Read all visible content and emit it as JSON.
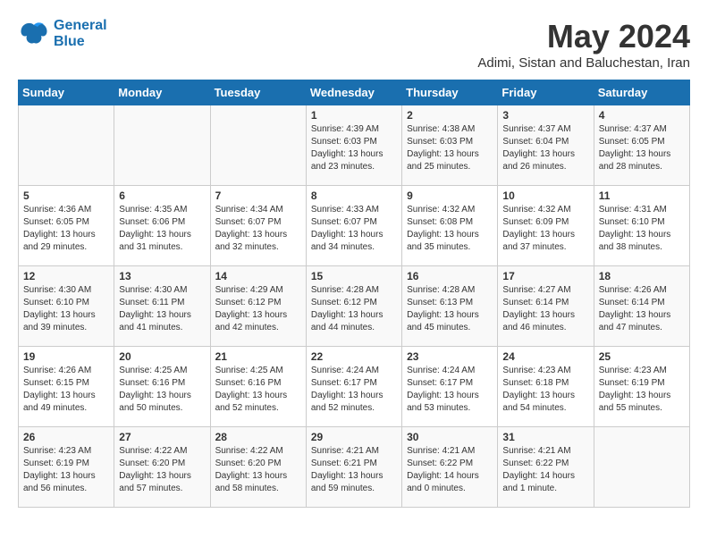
{
  "logo": {
    "line1": "General",
    "line2": "Blue"
  },
  "title": "May 2024",
  "subtitle": "Adimi, Sistan and Baluchestan, Iran",
  "days_of_week": [
    "Sunday",
    "Monday",
    "Tuesday",
    "Wednesday",
    "Thursday",
    "Friday",
    "Saturday"
  ],
  "weeks": [
    [
      {
        "day": "",
        "info": ""
      },
      {
        "day": "",
        "info": ""
      },
      {
        "day": "",
        "info": ""
      },
      {
        "day": "1",
        "info": "Sunrise: 4:39 AM\nSunset: 6:03 PM\nDaylight: 13 hours\nand 23 minutes."
      },
      {
        "day": "2",
        "info": "Sunrise: 4:38 AM\nSunset: 6:03 PM\nDaylight: 13 hours\nand 25 minutes."
      },
      {
        "day": "3",
        "info": "Sunrise: 4:37 AM\nSunset: 6:04 PM\nDaylight: 13 hours\nand 26 minutes."
      },
      {
        "day": "4",
        "info": "Sunrise: 4:37 AM\nSunset: 6:05 PM\nDaylight: 13 hours\nand 28 minutes."
      }
    ],
    [
      {
        "day": "5",
        "info": "Sunrise: 4:36 AM\nSunset: 6:05 PM\nDaylight: 13 hours\nand 29 minutes."
      },
      {
        "day": "6",
        "info": "Sunrise: 4:35 AM\nSunset: 6:06 PM\nDaylight: 13 hours\nand 31 minutes."
      },
      {
        "day": "7",
        "info": "Sunrise: 4:34 AM\nSunset: 6:07 PM\nDaylight: 13 hours\nand 32 minutes."
      },
      {
        "day": "8",
        "info": "Sunrise: 4:33 AM\nSunset: 6:07 PM\nDaylight: 13 hours\nand 34 minutes."
      },
      {
        "day": "9",
        "info": "Sunrise: 4:32 AM\nSunset: 6:08 PM\nDaylight: 13 hours\nand 35 minutes."
      },
      {
        "day": "10",
        "info": "Sunrise: 4:32 AM\nSunset: 6:09 PM\nDaylight: 13 hours\nand 37 minutes."
      },
      {
        "day": "11",
        "info": "Sunrise: 4:31 AM\nSunset: 6:10 PM\nDaylight: 13 hours\nand 38 minutes."
      }
    ],
    [
      {
        "day": "12",
        "info": "Sunrise: 4:30 AM\nSunset: 6:10 PM\nDaylight: 13 hours\nand 39 minutes."
      },
      {
        "day": "13",
        "info": "Sunrise: 4:30 AM\nSunset: 6:11 PM\nDaylight: 13 hours\nand 41 minutes."
      },
      {
        "day": "14",
        "info": "Sunrise: 4:29 AM\nSunset: 6:12 PM\nDaylight: 13 hours\nand 42 minutes."
      },
      {
        "day": "15",
        "info": "Sunrise: 4:28 AM\nSunset: 6:12 PM\nDaylight: 13 hours\nand 44 minutes."
      },
      {
        "day": "16",
        "info": "Sunrise: 4:28 AM\nSunset: 6:13 PM\nDaylight: 13 hours\nand 45 minutes."
      },
      {
        "day": "17",
        "info": "Sunrise: 4:27 AM\nSunset: 6:14 PM\nDaylight: 13 hours\nand 46 minutes."
      },
      {
        "day": "18",
        "info": "Sunrise: 4:26 AM\nSunset: 6:14 PM\nDaylight: 13 hours\nand 47 minutes."
      }
    ],
    [
      {
        "day": "19",
        "info": "Sunrise: 4:26 AM\nSunset: 6:15 PM\nDaylight: 13 hours\nand 49 minutes."
      },
      {
        "day": "20",
        "info": "Sunrise: 4:25 AM\nSunset: 6:16 PM\nDaylight: 13 hours\nand 50 minutes."
      },
      {
        "day": "21",
        "info": "Sunrise: 4:25 AM\nSunset: 6:16 PM\nDaylight: 13 hours\nand 52 minutes."
      },
      {
        "day": "22",
        "info": "Sunrise: 4:24 AM\nSunset: 6:17 PM\nDaylight: 13 hours\nand 52 minutes."
      },
      {
        "day": "23",
        "info": "Sunrise: 4:24 AM\nSunset: 6:17 PM\nDaylight: 13 hours\nand 53 minutes."
      },
      {
        "day": "24",
        "info": "Sunrise: 4:23 AM\nSunset: 6:18 PM\nDaylight: 13 hours\nand 54 minutes."
      },
      {
        "day": "25",
        "info": "Sunrise: 4:23 AM\nSunset: 6:19 PM\nDaylight: 13 hours\nand 55 minutes."
      }
    ],
    [
      {
        "day": "26",
        "info": "Sunrise: 4:23 AM\nSunset: 6:19 PM\nDaylight: 13 hours\nand 56 minutes."
      },
      {
        "day": "27",
        "info": "Sunrise: 4:22 AM\nSunset: 6:20 PM\nDaylight: 13 hours\nand 57 minutes."
      },
      {
        "day": "28",
        "info": "Sunrise: 4:22 AM\nSunset: 6:20 PM\nDaylight: 13 hours\nand 58 minutes."
      },
      {
        "day": "29",
        "info": "Sunrise: 4:21 AM\nSunset: 6:21 PM\nDaylight: 13 hours\nand 59 minutes."
      },
      {
        "day": "30",
        "info": "Sunrise: 4:21 AM\nSunset: 6:22 PM\nDaylight: 14 hours\nand 0 minutes."
      },
      {
        "day": "31",
        "info": "Sunrise: 4:21 AM\nSunset: 6:22 PM\nDaylight: 14 hours\nand 1 minute."
      },
      {
        "day": "",
        "info": ""
      }
    ]
  ]
}
